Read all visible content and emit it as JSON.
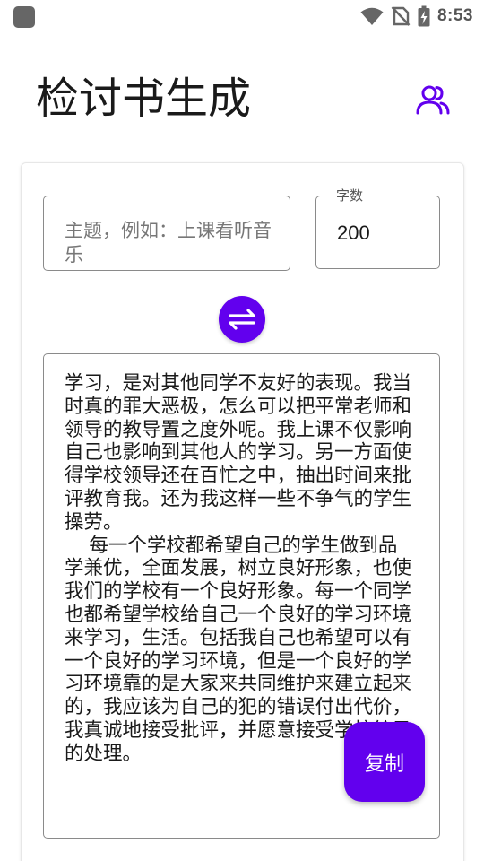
{
  "status_bar": {
    "time": "8:53",
    "icons": [
      "app-icon",
      "wifi-icon",
      "no-sim-icon",
      "battery-charging-icon"
    ]
  },
  "header": {
    "title": "检讨书生成",
    "action_icon": "users-icon"
  },
  "form": {
    "topic": {
      "placeholder": "主题，例如：上课看听音乐",
      "value": ""
    },
    "word_count": {
      "label": "字数",
      "value": "200"
    },
    "generate_icon": "swap-arrows-icon"
  },
  "output": {
    "text": "学习，是对其他同学不友好的表现。我当时真的罪大恶极，怎么可以把平常老师和领导的教导置之度外呢。我上课不仅影响自己也影响到其他人的学习。另一方面使得学校领导还在百忙之中，抽出时间来批评教育我。还为我这样一些不争气的学生操劳。\n    每一个学校都希望自己的学生做到品学兼优，全面发展，树立良好形象，也使我们的学校有一个良好形象。每一个同学也都希望学校给自己一个良好的学习环境来学习，生活。包括我自己也希望可以有一个良好的学习环境，但是一个良好的学习环境靠的是大家来共同维护来建立起来的，我应该为自己的犯的错误付出代价，我真诚地接受批评，并愿意接受学校给予的处理。"
  },
  "copy_button": {
    "label": "复制"
  },
  "colors": {
    "accent": "#6200ee",
    "border": "#8a8a8a",
    "placeholder": "#777777",
    "status_icons": "#666666"
  }
}
